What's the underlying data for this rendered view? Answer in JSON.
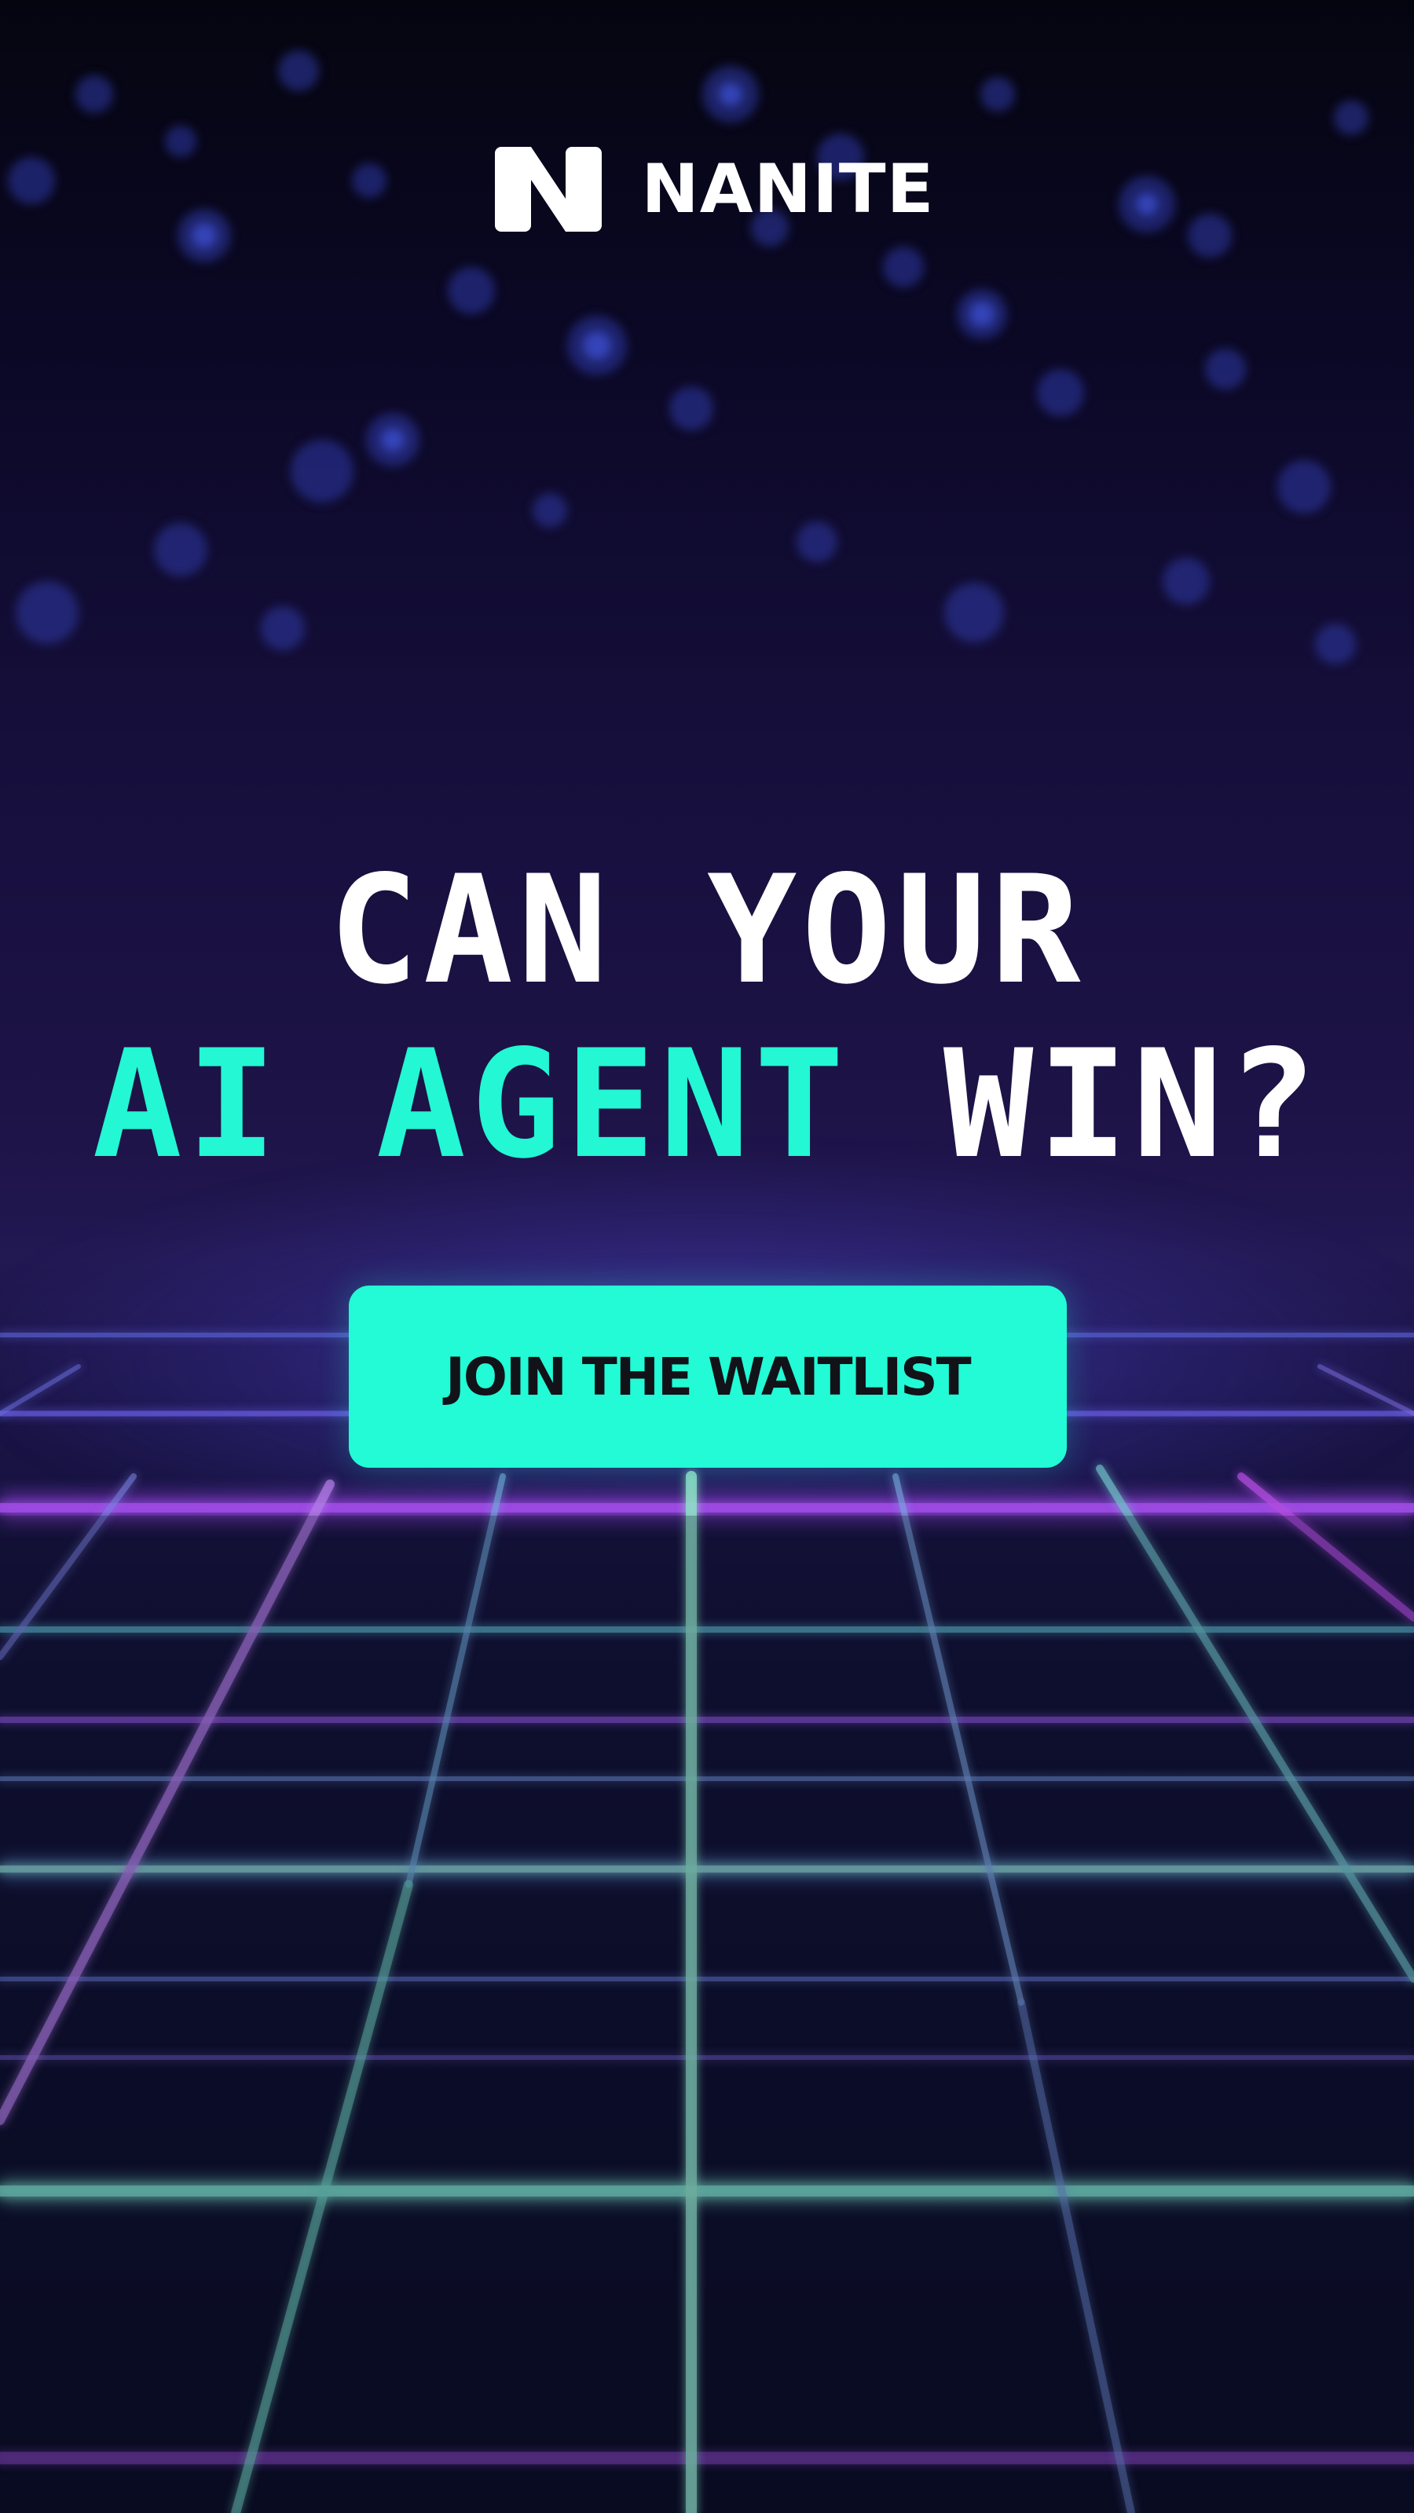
{
  "brand": {
    "name": "NANITE",
    "logo_icon": "nanite-n-logo-icon"
  },
  "headline": {
    "line1": "CAN YOUR",
    "line2_accent": "AI AGENT",
    "line2_rest": "WIN?"
  },
  "cta": {
    "label": "JOIN THE WAITLIST"
  },
  "colors": {
    "accent": "#23f7d3",
    "button": "#22fbd5",
    "button_text": "#121219",
    "background": "#1a1446",
    "grid_purple": "#a04ce6",
    "grid_teal": "#6fe0c6"
  }
}
